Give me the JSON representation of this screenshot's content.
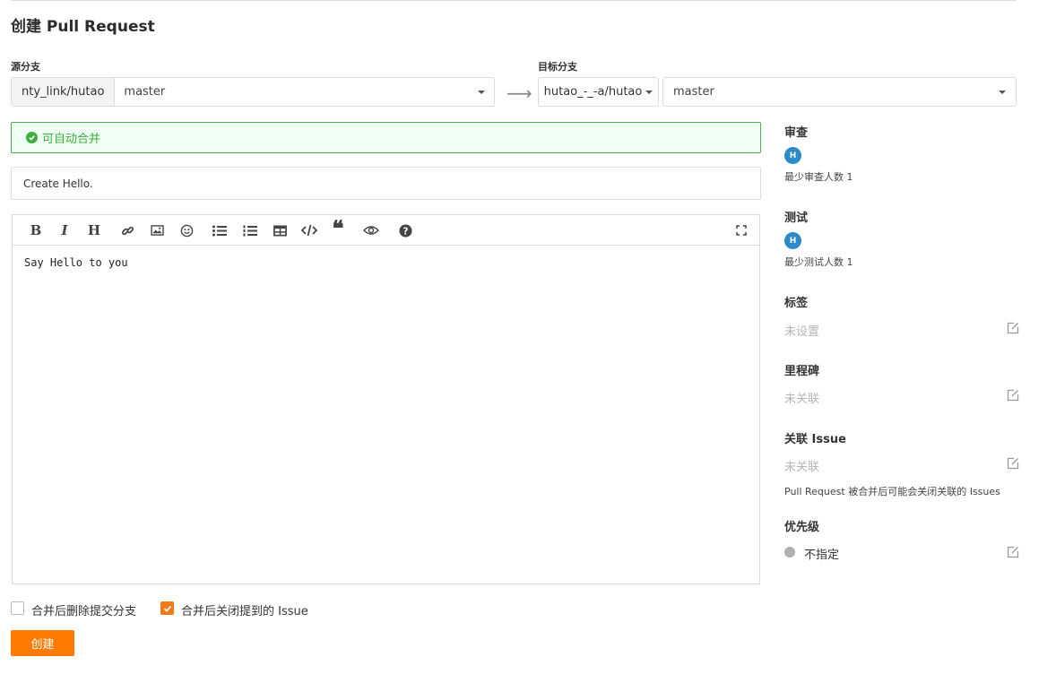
{
  "page": {
    "title": "创建 Pull Request"
  },
  "source": {
    "label": "源分支",
    "repo": "nty_link/hutao",
    "branch": "master"
  },
  "target": {
    "label": "目标分支",
    "repo": "hutao_-_-a/hutao",
    "branch": "master"
  },
  "merge_status": {
    "text": "可自动合并",
    "color": "#3cae3c"
  },
  "form": {
    "title_value": "Create Hello.",
    "body": "Say Hello to you",
    "toolbar_icons": [
      "bold-icon",
      "italic-icon",
      "heading-icon",
      "link-icon",
      "image-icon",
      "emoji-icon",
      "unordered-list-icon",
      "ordered-list-icon",
      "table-icon",
      "code-icon",
      "quote-icon",
      "preview-icon",
      "help-icon",
      "fullscreen-icon"
    ]
  },
  "options": {
    "delete_branch": {
      "label": "合并后删除提交分支",
      "checked": false
    },
    "close_issue": {
      "label": "合并后关闭提到的 Issue",
      "checked": true
    }
  },
  "actions": {
    "create_label": "创建",
    "accent": "#ff7a00"
  },
  "sidebar": {
    "review": {
      "title": "审查",
      "avatar": "H",
      "note": "最少审查人数 1"
    },
    "testing": {
      "title": "测试",
      "avatar": "H",
      "note": "最少测试人数 1"
    },
    "labels": {
      "title": "标签",
      "value": "未设置"
    },
    "milestone": {
      "title": "里程碑",
      "value": "未关联"
    },
    "issue": {
      "title": "关联 Issue",
      "value": "未关联",
      "note": "Pull Request 被合并后可能会关闭关联的 Issues"
    },
    "priority": {
      "title": "优先级",
      "value": "不指定"
    }
  }
}
